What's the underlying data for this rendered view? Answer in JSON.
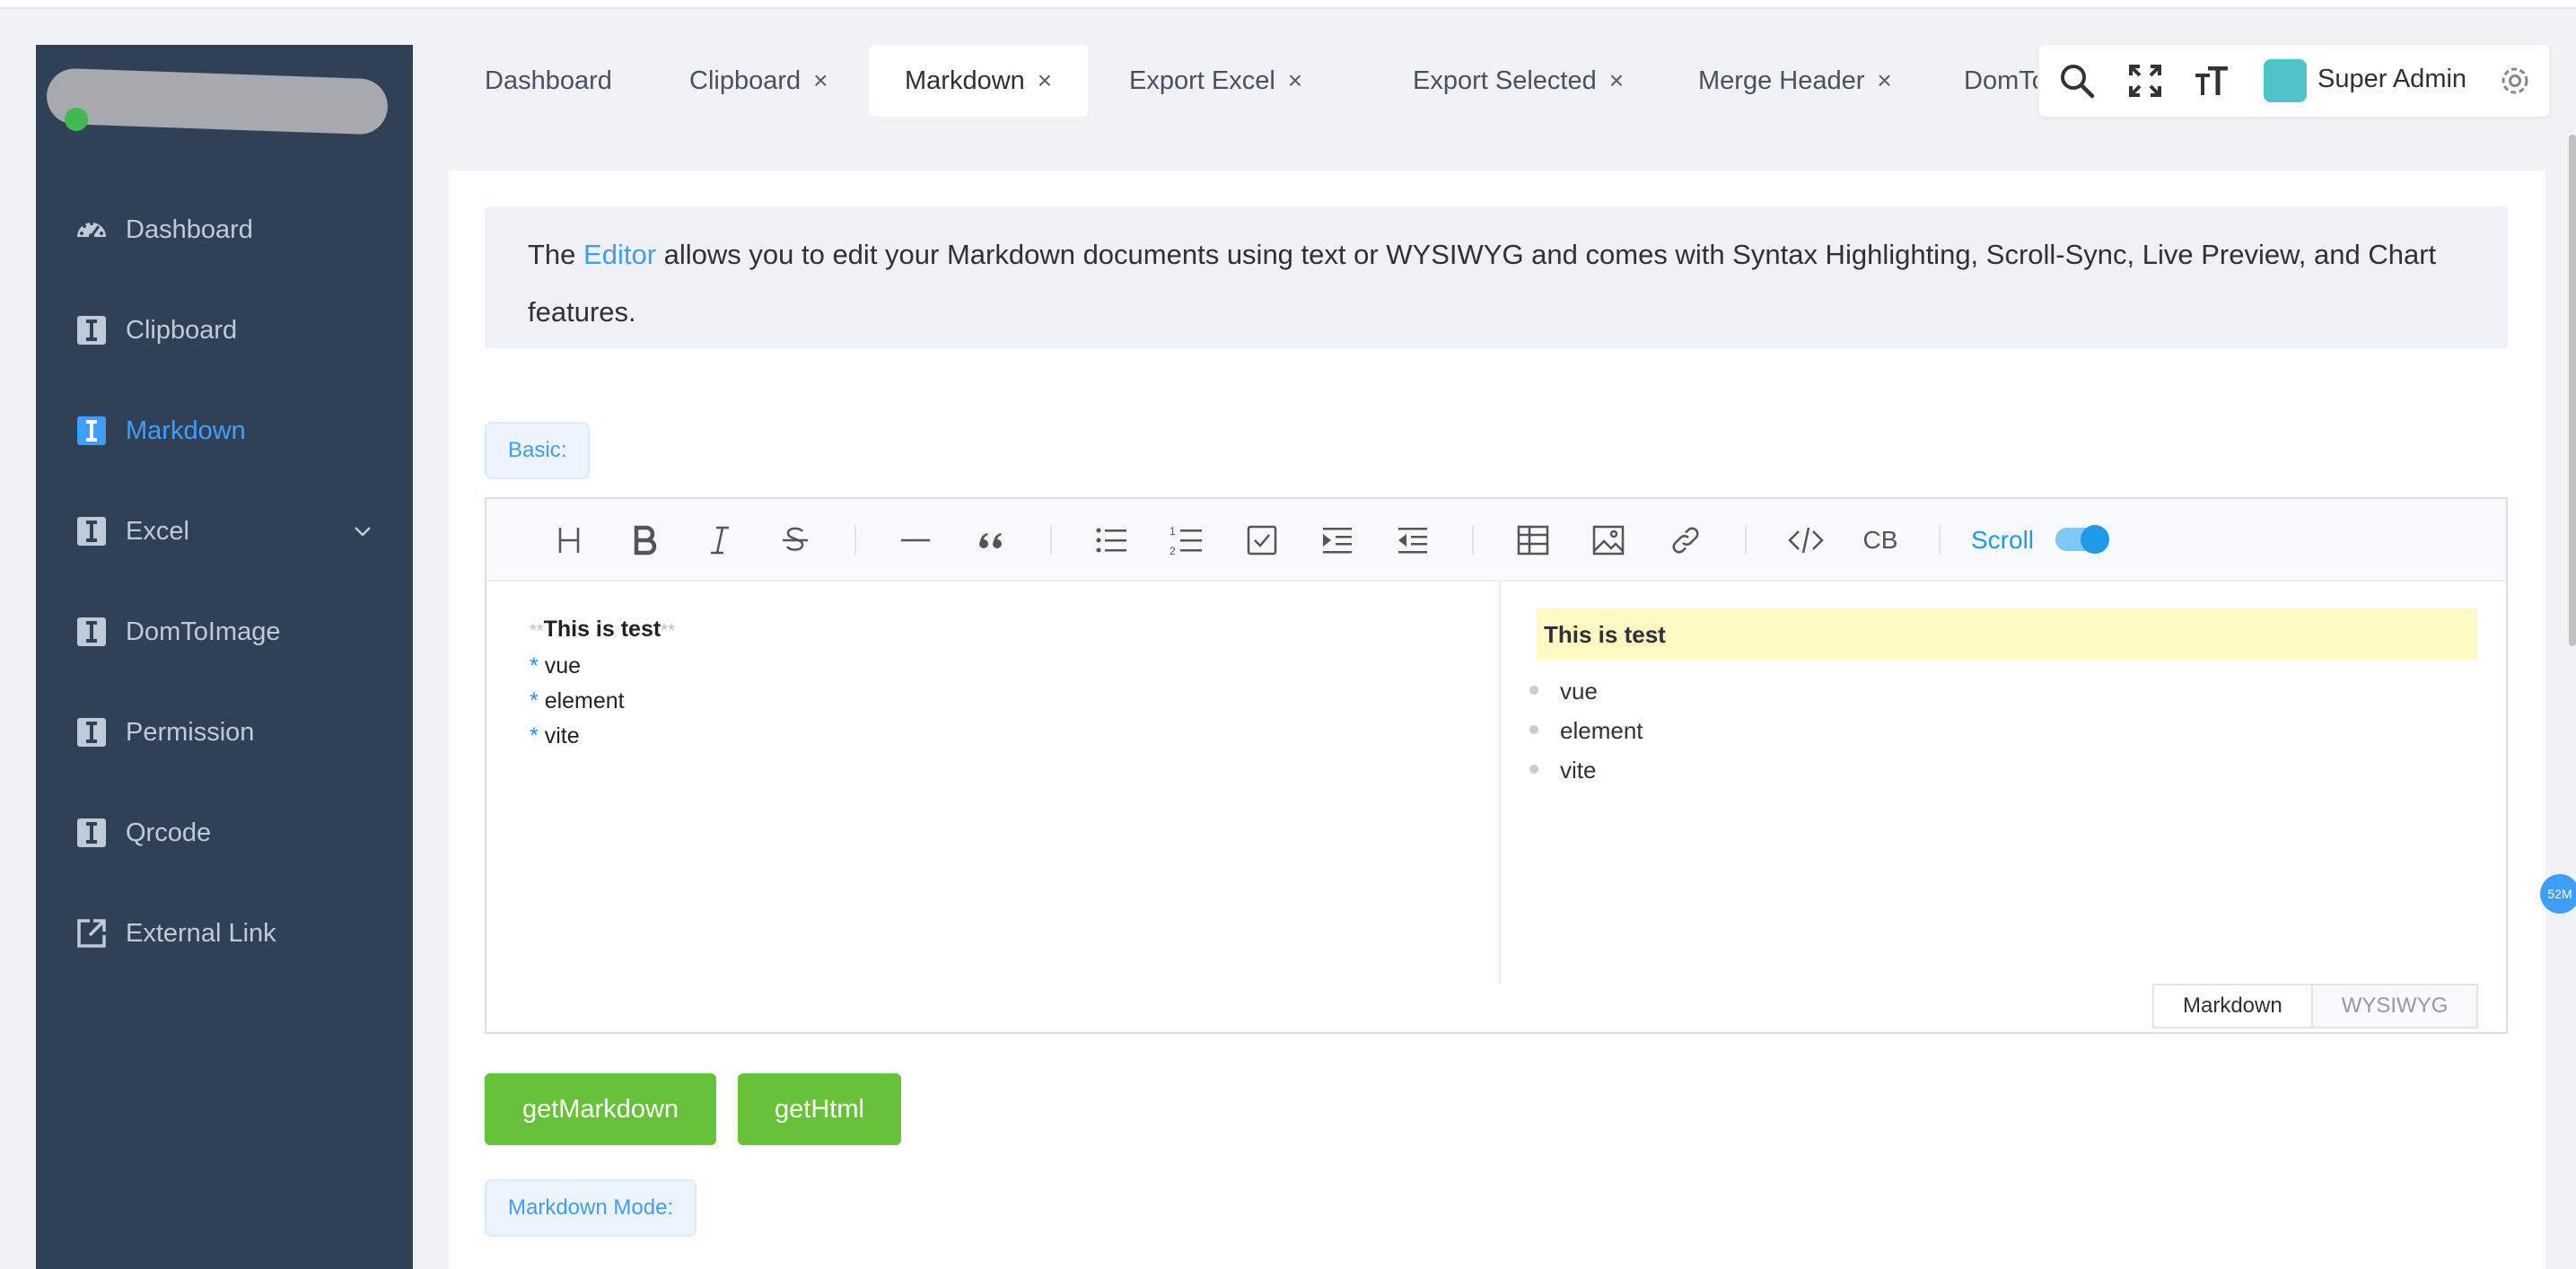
{
  "sidebar": {
    "items": [
      {
        "label": "Dashboard",
        "icon": "dashboard-icon",
        "active": false
      },
      {
        "label": "Clipboard",
        "icon": "doc-icon",
        "active": false
      },
      {
        "label": "Markdown",
        "icon": "doc-icon",
        "active": true
      },
      {
        "label": "Excel",
        "icon": "doc-icon",
        "active": false,
        "expandable": true
      },
      {
        "label": "DomToImage",
        "icon": "doc-icon",
        "active": false
      },
      {
        "label": "Permission",
        "icon": "doc-icon",
        "active": false
      },
      {
        "label": "Qrcode",
        "icon": "doc-icon",
        "active": false
      },
      {
        "label": "External Link",
        "icon": "external-link-icon",
        "active": false
      }
    ]
  },
  "tabs": [
    {
      "label": "Dashboard",
      "closable": false,
      "active": false
    },
    {
      "label": "Clipboard",
      "closable": true,
      "active": false
    },
    {
      "label": "Markdown",
      "closable": true,
      "active": true
    },
    {
      "label": "Export Excel",
      "closable": true,
      "active": false
    },
    {
      "label": "Export Selected",
      "closable": true,
      "active": false
    },
    {
      "label": "Merge Header",
      "closable": true,
      "active": false
    },
    {
      "label": "DomToI",
      "closable": false,
      "active": false
    }
  ],
  "header": {
    "close_glyph": "×",
    "user_name": "Super Admin"
  },
  "tip": {
    "before": "The ",
    "link": "Editor",
    "after": " allows you to edit your Markdown documents using text or WYSIWYG and comes with Syntax Highlighting, Scroll-Sync, Live Preview, and Chart features."
  },
  "sections": {
    "basic_label": "Basic:",
    "markdown_mode_label": "Markdown Mode:"
  },
  "editor": {
    "scroll_label": "Scroll",
    "scroll_on": true,
    "codeblock_label": "CB",
    "markdown_source": {
      "bold_marker": "**",
      "bold_text": "This is test",
      "bullet": "*",
      "items": [
        "vue",
        "element",
        "vite"
      ]
    },
    "preview": {
      "heading": "This is test",
      "items": [
        "vue",
        "element",
        "vite"
      ]
    },
    "mode_tabs": {
      "markdown": "Markdown",
      "wysiwyg": "WYSIWYG"
    }
  },
  "buttons": {
    "get_markdown": "getMarkdown",
    "get_html": "getHtml"
  },
  "float_badge": "52M",
  "colors": {
    "sidebar_bg": "#304156",
    "accent": "#409eff",
    "success": "#67c23a"
  }
}
